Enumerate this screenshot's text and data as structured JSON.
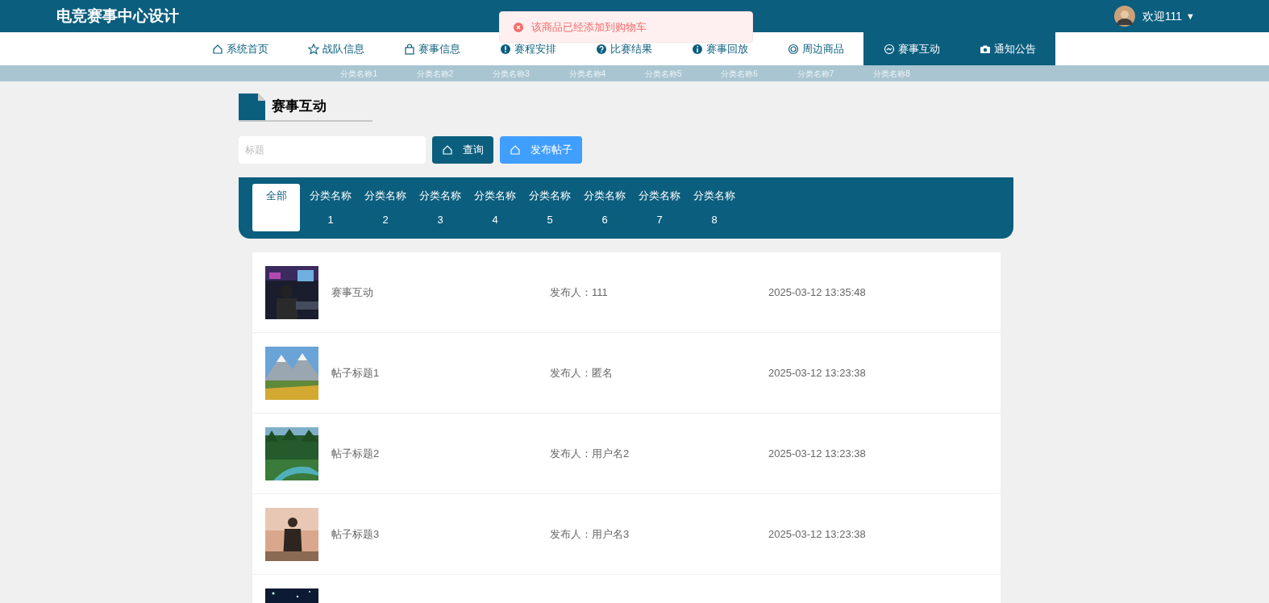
{
  "header": {
    "title": "电竞赛事中心设计",
    "user": "欢迎111",
    "caret": "▼"
  },
  "toast": {
    "text": "该商品已经添加到购物车"
  },
  "nav": [
    {
      "label": "系统首页",
      "selected": false
    },
    {
      "label": "战队信息",
      "selected": false
    },
    {
      "label": "赛事信息",
      "selected": false
    },
    {
      "label": "赛程安排",
      "selected": false
    },
    {
      "label": "比赛结果",
      "selected": false
    },
    {
      "label": "赛事回放",
      "selected": false
    },
    {
      "label": "周边商品",
      "selected": false
    },
    {
      "label": "赛事互动",
      "selected": true
    },
    {
      "label": "通知公告",
      "selected": true
    }
  ],
  "submenu": [
    "分类名称1",
    "分类名称2",
    "分类名称3",
    "分类名称4",
    "分类名称5",
    "分类名称6",
    "分类名称7",
    "分类名称8"
  ],
  "page_title": "赛事互动",
  "search": {
    "placeholder": "标题",
    "query_button": "查询",
    "post_button": "发布帖子"
  },
  "categories": [
    {
      "label": "全部",
      "selected": true
    },
    {
      "label": "分类名称1",
      "selected": false
    },
    {
      "label": "分类名称2",
      "selected": false
    },
    {
      "label": "分类名称3",
      "selected": false
    },
    {
      "label": "分类名称4",
      "selected": false
    },
    {
      "label": "分类名称5",
      "selected": false
    },
    {
      "label": "分类名称6",
      "selected": false
    },
    {
      "label": "分类名称7",
      "selected": false
    },
    {
      "label": "分类名称8",
      "selected": false
    }
  ],
  "posts": [
    {
      "kind": "picture",
      "title": "赛事互动",
      "author": "发布人：111",
      "time": "2025-03-12 13:35:48"
    },
    {
      "kind": "picture",
      "title": "帖子标题1",
      "author": "发布人：匿名",
      "time": "2025-03-12 13:23:38"
    },
    {
      "kind": "picture",
      "title": "帖子标题2",
      "author": "发布人：用户名2",
      "time": "2025-03-12 13:23:38"
    },
    {
      "kind": "picture",
      "title": "帖子标题3",
      "author": "发布人：用户名3",
      "time": "2025-03-12 13:23:38"
    },
    {
      "kind": "picture"
    }
  ]
}
